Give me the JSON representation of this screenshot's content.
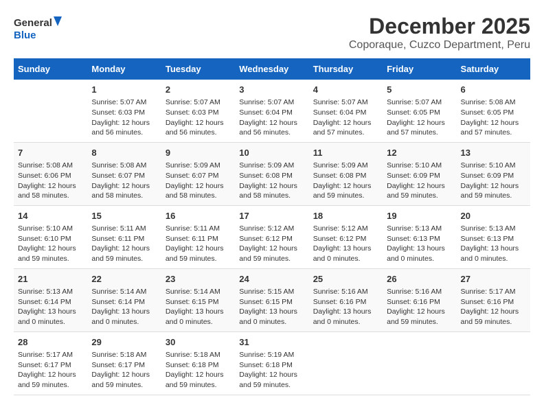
{
  "logo": {
    "line1": "General",
    "line2": "Blue"
  },
  "title": "December 2025",
  "subtitle": "Coporaque, Cuzco Department, Peru",
  "days_header": [
    "Sunday",
    "Monday",
    "Tuesday",
    "Wednesday",
    "Thursday",
    "Friday",
    "Saturday"
  ],
  "weeks": [
    [
      {
        "day": "",
        "info": ""
      },
      {
        "day": "1",
        "info": "Sunrise: 5:07 AM\nSunset: 6:03 PM\nDaylight: 12 hours\nand 56 minutes."
      },
      {
        "day": "2",
        "info": "Sunrise: 5:07 AM\nSunset: 6:03 PM\nDaylight: 12 hours\nand 56 minutes."
      },
      {
        "day": "3",
        "info": "Sunrise: 5:07 AM\nSunset: 6:04 PM\nDaylight: 12 hours\nand 56 minutes."
      },
      {
        "day": "4",
        "info": "Sunrise: 5:07 AM\nSunset: 6:04 PM\nDaylight: 12 hours\nand 57 minutes."
      },
      {
        "day": "5",
        "info": "Sunrise: 5:07 AM\nSunset: 6:05 PM\nDaylight: 12 hours\nand 57 minutes."
      },
      {
        "day": "6",
        "info": "Sunrise: 5:08 AM\nSunset: 6:05 PM\nDaylight: 12 hours\nand 57 minutes."
      }
    ],
    [
      {
        "day": "7",
        "info": "Sunrise: 5:08 AM\nSunset: 6:06 PM\nDaylight: 12 hours\nand 58 minutes."
      },
      {
        "day": "8",
        "info": "Sunrise: 5:08 AM\nSunset: 6:07 PM\nDaylight: 12 hours\nand 58 minutes."
      },
      {
        "day": "9",
        "info": "Sunrise: 5:09 AM\nSunset: 6:07 PM\nDaylight: 12 hours\nand 58 minutes."
      },
      {
        "day": "10",
        "info": "Sunrise: 5:09 AM\nSunset: 6:08 PM\nDaylight: 12 hours\nand 58 minutes."
      },
      {
        "day": "11",
        "info": "Sunrise: 5:09 AM\nSunset: 6:08 PM\nDaylight: 12 hours\nand 59 minutes."
      },
      {
        "day": "12",
        "info": "Sunrise: 5:10 AM\nSunset: 6:09 PM\nDaylight: 12 hours\nand 59 minutes."
      },
      {
        "day": "13",
        "info": "Sunrise: 5:10 AM\nSunset: 6:09 PM\nDaylight: 12 hours\nand 59 minutes."
      }
    ],
    [
      {
        "day": "14",
        "info": "Sunrise: 5:10 AM\nSunset: 6:10 PM\nDaylight: 12 hours\nand 59 minutes."
      },
      {
        "day": "15",
        "info": "Sunrise: 5:11 AM\nSunset: 6:11 PM\nDaylight: 12 hours\nand 59 minutes."
      },
      {
        "day": "16",
        "info": "Sunrise: 5:11 AM\nSunset: 6:11 PM\nDaylight: 12 hours\nand 59 minutes."
      },
      {
        "day": "17",
        "info": "Sunrise: 5:12 AM\nSunset: 6:12 PM\nDaylight: 12 hours\nand 59 minutes."
      },
      {
        "day": "18",
        "info": "Sunrise: 5:12 AM\nSunset: 6:12 PM\nDaylight: 13 hours\nand 0 minutes."
      },
      {
        "day": "19",
        "info": "Sunrise: 5:13 AM\nSunset: 6:13 PM\nDaylight: 13 hours\nand 0 minutes."
      },
      {
        "day": "20",
        "info": "Sunrise: 5:13 AM\nSunset: 6:13 PM\nDaylight: 13 hours\nand 0 minutes."
      }
    ],
    [
      {
        "day": "21",
        "info": "Sunrise: 5:13 AM\nSunset: 6:14 PM\nDaylight: 13 hours\nand 0 minutes."
      },
      {
        "day": "22",
        "info": "Sunrise: 5:14 AM\nSunset: 6:14 PM\nDaylight: 13 hours\nand 0 minutes."
      },
      {
        "day": "23",
        "info": "Sunrise: 5:14 AM\nSunset: 6:15 PM\nDaylight: 13 hours\nand 0 minutes."
      },
      {
        "day": "24",
        "info": "Sunrise: 5:15 AM\nSunset: 6:15 PM\nDaylight: 13 hours\nand 0 minutes."
      },
      {
        "day": "25",
        "info": "Sunrise: 5:16 AM\nSunset: 6:16 PM\nDaylight: 13 hours\nand 0 minutes."
      },
      {
        "day": "26",
        "info": "Sunrise: 5:16 AM\nSunset: 6:16 PM\nDaylight: 12 hours\nand 59 minutes."
      },
      {
        "day": "27",
        "info": "Sunrise: 5:17 AM\nSunset: 6:16 PM\nDaylight: 12 hours\nand 59 minutes."
      }
    ],
    [
      {
        "day": "28",
        "info": "Sunrise: 5:17 AM\nSunset: 6:17 PM\nDaylight: 12 hours\nand 59 minutes."
      },
      {
        "day": "29",
        "info": "Sunrise: 5:18 AM\nSunset: 6:17 PM\nDaylight: 12 hours\nand 59 minutes."
      },
      {
        "day": "30",
        "info": "Sunrise: 5:18 AM\nSunset: 6:18 PM\nDaylight: 12 hours\nand 59 minutes."
      },
      {
        "day": "31",
        "info": "Sunrise: 5:19 AM\nSunset: 6:18 PM\nDaylight: 12 hours\nand 59 minutes."
      },
      {
        "day": "",
        "info": ""
      },
      {
        "day": "",
        "info": ""
      },
      {
        "day": "",
        "info": ""
      }
    ]
  ]
}
